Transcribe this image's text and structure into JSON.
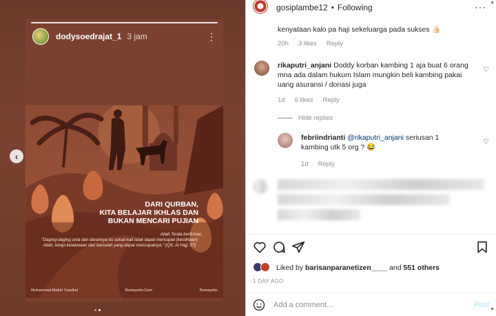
{
  "story": {
    "username": "dodysoedrajat_1",
    "time": "3 jam",
    "more": "⋮",
    "poster": {
      "title_lines": [
        "DARI QURBAN,",
        "KITA BELAJAR IKHLAS DAN",
        "BUKAN MENCARI PUJIAN"
      ],
      "quote_intro": "Allah Ta'ala berfirman,",
      "quote": "\"Daging-daging unta dan darahnya itu sekali-kali tidak dapat mencapai (keridhaan) Allah, tetapi ketakwaan dari kamulah yang dapat mencapainya.\"",
      "quote_source": "(QS. Al Hajj: 37)",
      "footer_author": "Muhammad Abduh Tuasikal",
      "footer_site1": "Rumaysho.Com",
      "footer_site2": "Rumaysho"
    }
  },
  "header": {
    "username": "gosiplambe12",
    "separator": "•",
    "follow_status": "Following",
    "more": "···"
  },
  "comments": {
    "previous": {
      "text": "kenyataan kalo pa haji sekeluarga pada sukses 👍🏻",
      "time": "20h",
      "likes": "3 likes",
      "reply": "Reply"
    },
    "main": {
      "username": "rikaputri_anjani",
      "text": "Doddy korban kambing 1 aja buat 6 orang mna ada dalam hukum Islam mungkin beli kambing pakai uang asuransi / donasi juga",
      "time": "1d",
      "likes": "6 likes",
      "reply": "Reply",
      "hide_replies": "Hide replies"
    },
    "reply": {
      "username": "febriindrianti",
      "mention": "@rikaputri_anjani",
      "text": "seriusan 1 kambing utk 5 org ? 😂",
      "time": "1d",
      "reply": "Reply"
    }
  },
  "likes": {
    "prefix": "Liked by",
    "user": "barisanparanetizen____",
    "middle": "and",
    "count": "551 others"
  },
  "time_ago": "1 DAY AGO",
  "comment_input": {
    "placeholder": "Add a comment...",
    "post": "Post"
  }
}
